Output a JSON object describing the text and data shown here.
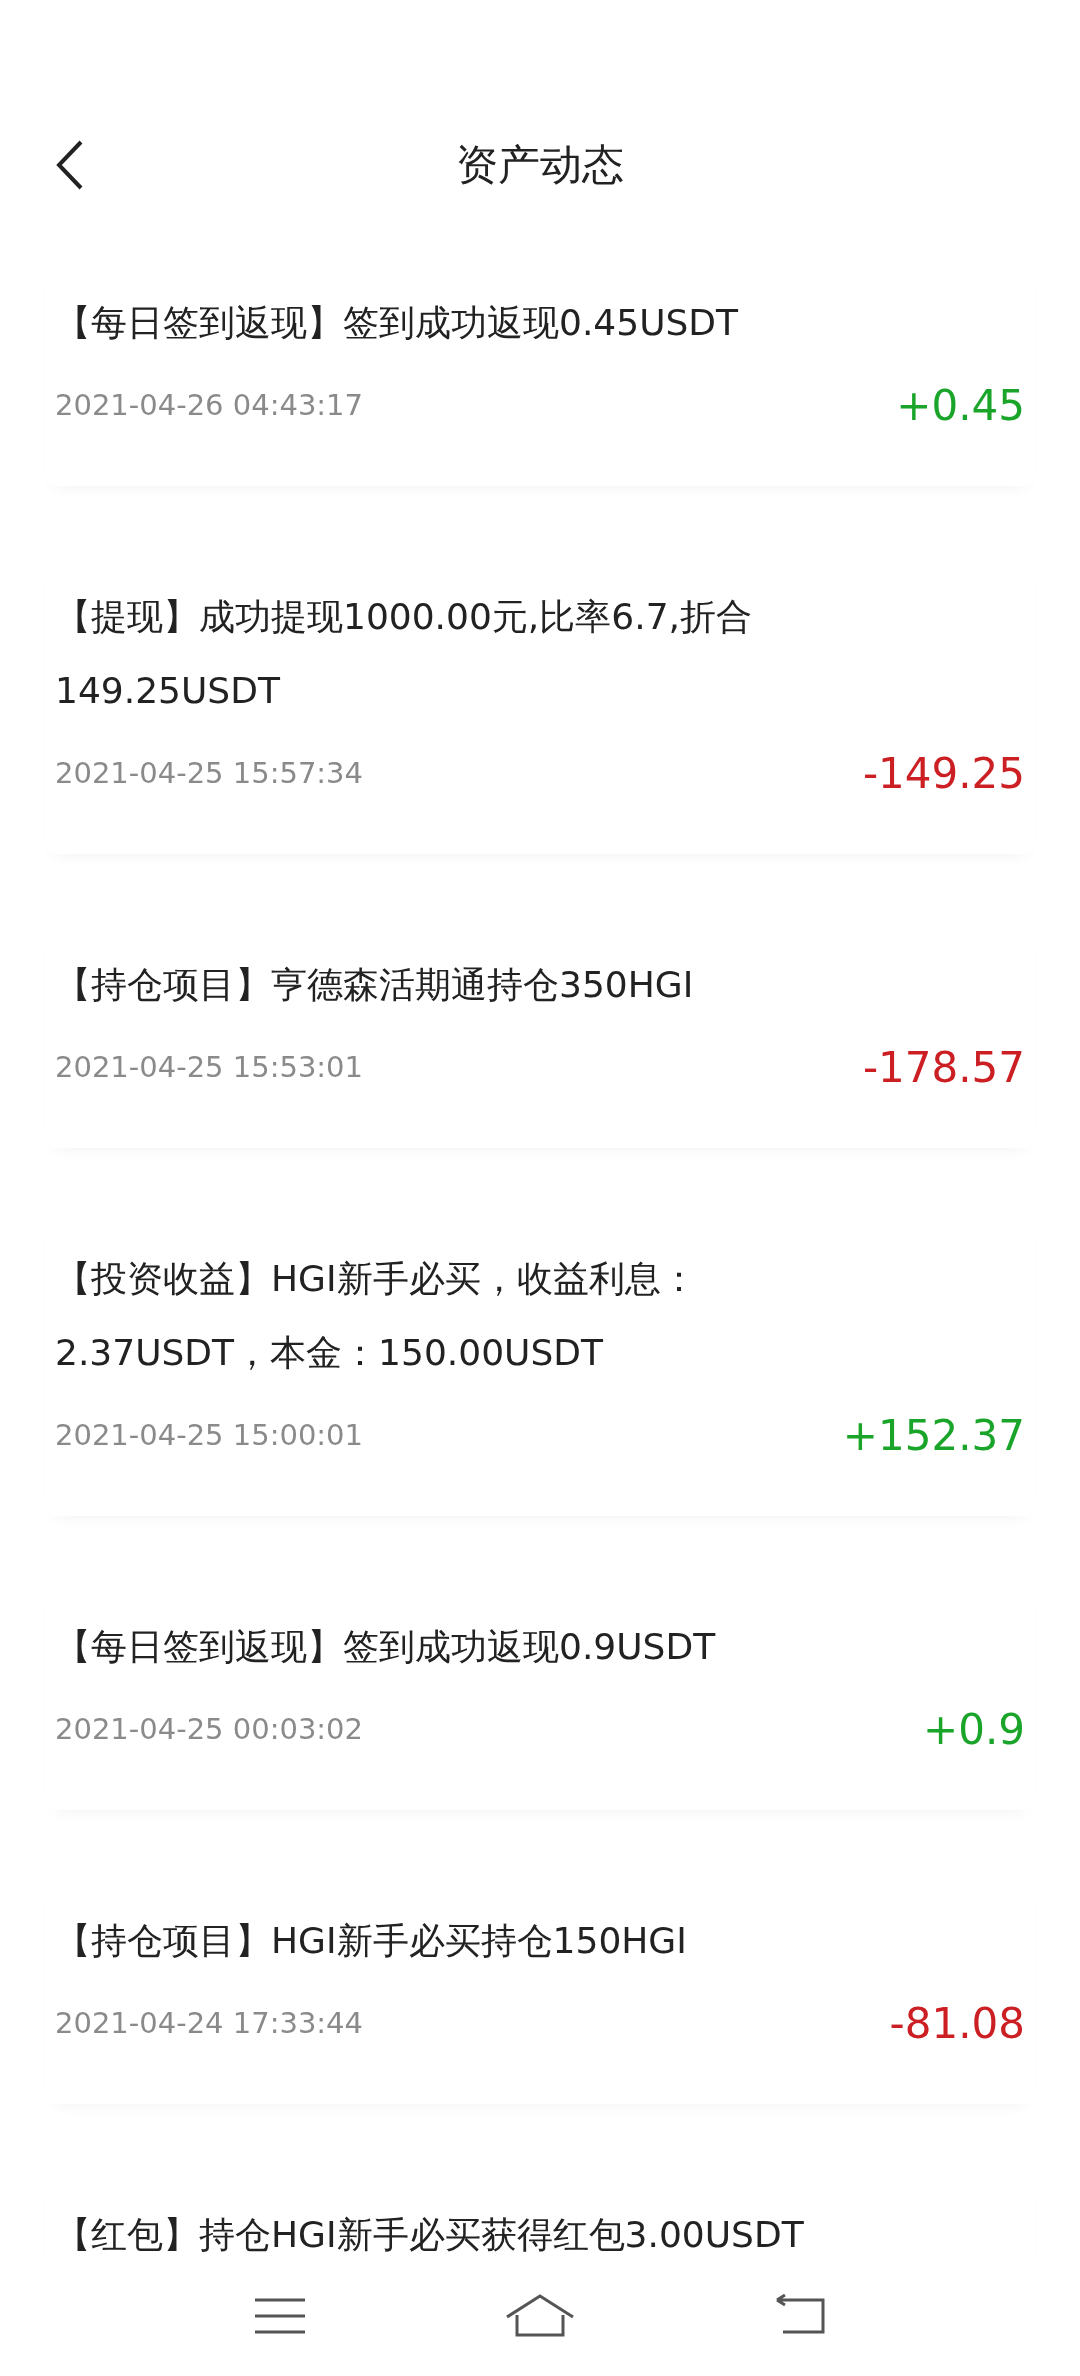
{
  "header": {
    "title": "资产动态"
  },
  "records": [
    {
      "text": "【每日签到返现】签到成功返现0.45USDT",
      "time": "2021-04-26 04:43:17",
      "amount": "+0.45",
      "color": "#1aa52a"
    },
    {
      "text": "【提现】成功提现1000.00元,比率6.7,折合149.25USDT",
      "time": "2021-04-25 15:57:34",
      "amount": "-149.25",
      "color": "#cc1f24"
    },
    {
      "text": "【持仓项目】亨德森活期通持仓350HGI",
      "time": "2021-04-25 15:53:01",
      "amount": "-178.57",
      "color": "#cc1f24"
    },
    {
      "text": "【投资收益】HGI新手必买，收益利息：2.37USDT，本金：150.00USDT",
      "time": "2021-04-25 15:00:01",
      "amount": "+152.37",
      "color": "#1aa52a"
    },
    {
      "text": "【每日签到返现】签到成功返现0.9USDT",
      "time": "2021-04-25 00:03:02",
      "amount": "+0.9",
      "color": "#1aa52a"
    },
    {
      "text": "【持仓项目】HGI新手必买持仓150HGI",
      "time": "2021-04-24 17:33:44",
      "amount": "-81.08",
      "color": "#cc1f24"
    },
    {
      "text": "【红包】持仓HGI新手必买获得红包3.00USDT"
    }
  ]
}
